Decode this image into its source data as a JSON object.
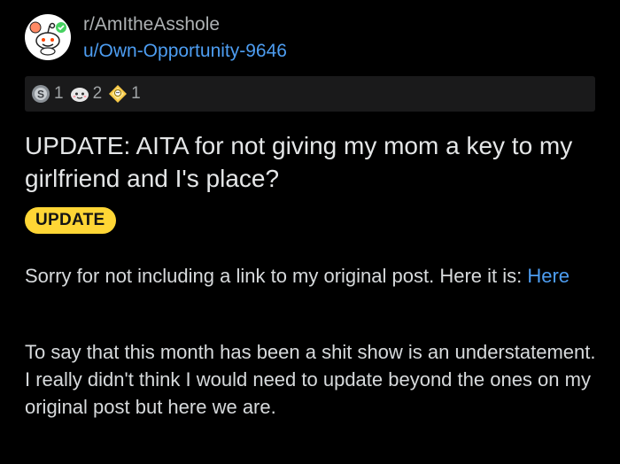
{
  "post": {
    "subreddit": "r/AmItheAsshole",
    "username": "u/Own-Opportunity-9646",
    "title": "UPDATE: AITA for not giving my mom a key to my girlfriend and I's place?",
    "flair": "UPDATE",
    "flair_color": "#ffd635",
    "link_color": "#4d9df1",
    "awards": [
      {
        "icon": "silver-award-icon",
        "count": "1"
      },
      {
        "icon": "wholesome-award-icon",
        "count": "2"
      },
      {
        "icon": "helpful-award-icon",
        "count": "1"
      }
    ],
    "body": {
      "p1_text": "Sorry for not including a link to my original post. Here it is: ",
      "p1_link": "Here",
      "p2_text": "To say that this month has been a shit show is an understatement. I really didn't think I would need to update beyond the ones on my original post but here we are."
    }
  }
}
